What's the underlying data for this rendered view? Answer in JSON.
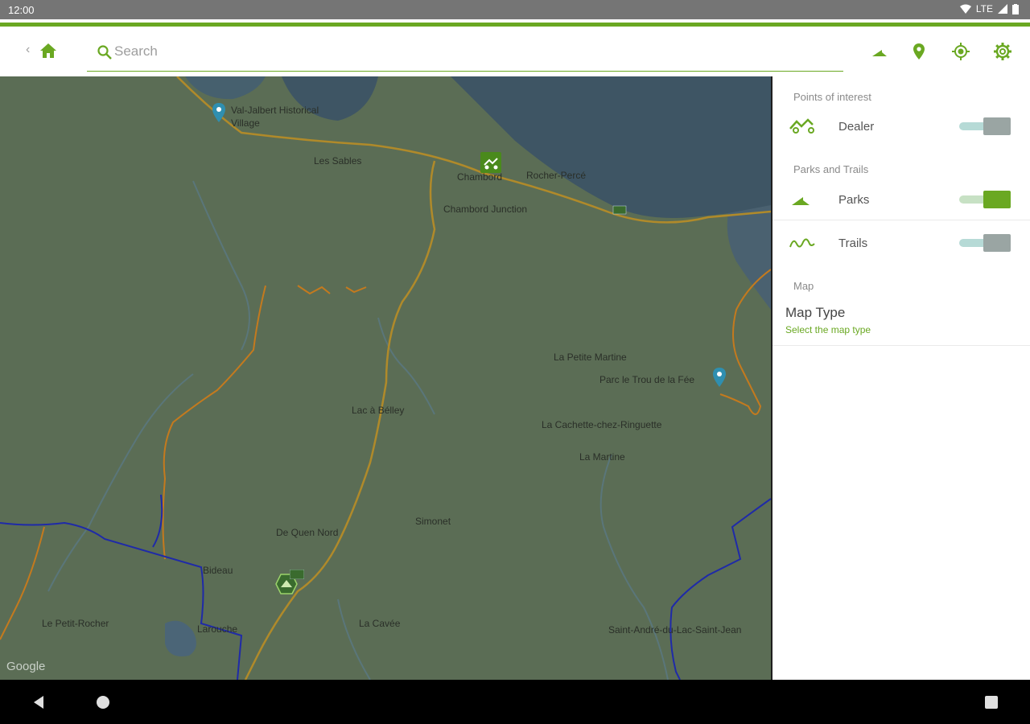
{
  "status_bar": {
    "time": "12:00",
    "network": "LTE"
  },
  "toolbar": {
    "search_placeholder": "Search",
    "icons": [
      "back-chevron-icon",
      "home-icon",
      "search-icon",
      "parks-icon",
      "location-pin-icon",
      "my-location-icon",
      "settings-icon"
    ]
  },
  "colors": {
    "accent": "#6aa822",
    "map_base": "#5b6d55",
    "water": "#3e5564",
    "trail": "#c47a1e",
    "border": "#1f2aa8"
  },
  "map": {
    "attribution": "Google",
    "labels": [
      {
        "name": "Val-Jalbert Historical Village"
      },
      {
        "name": "Les Sables"
      },
      {
        "name": "Chambord"
      },
      {
        "name": "Rocher-Percé"
      },
      {
        "name": "Chambord Junction"
      },
      {
        "name": "La Petite Martine"
      },
      {
        "name": "Parc le Trou de la Fée"
      },
      {
        "name": "Lac à Bélley"
      },
      {
        "name": "La Cachette-chez-Ringuette"
      },
      {
        "name": "La Martine"
      },
      {
        "name": "Simonet"
      },
      {
        "name": "De Quen Nord"
      },
      {
        "name": "Bideau"
      },
      {
        "name": "Le Petit-Rocher"
      },
      {
        "name": "La Cavée"
      },
      {
        "name": "Saint-André-du-Lac-Saint-Jean"
      },
      {
        "name": "Larouche"
      }
    ]
  },
  "panel": {
    "poi_section": "Points of interest",
    "dealer_label": "Dealer",
    "dealer_on": false,
    "parks_section": "Parks and Trails",
    "parks_label": "Parks",
    "parks_on": true,
    "trails_label": "Trails",
    "trails_on": false,
    "map_section": "Map",
    "map_type_title": "Map Type",
    "map_type_subtitle": "Select the map type"
  }
}
